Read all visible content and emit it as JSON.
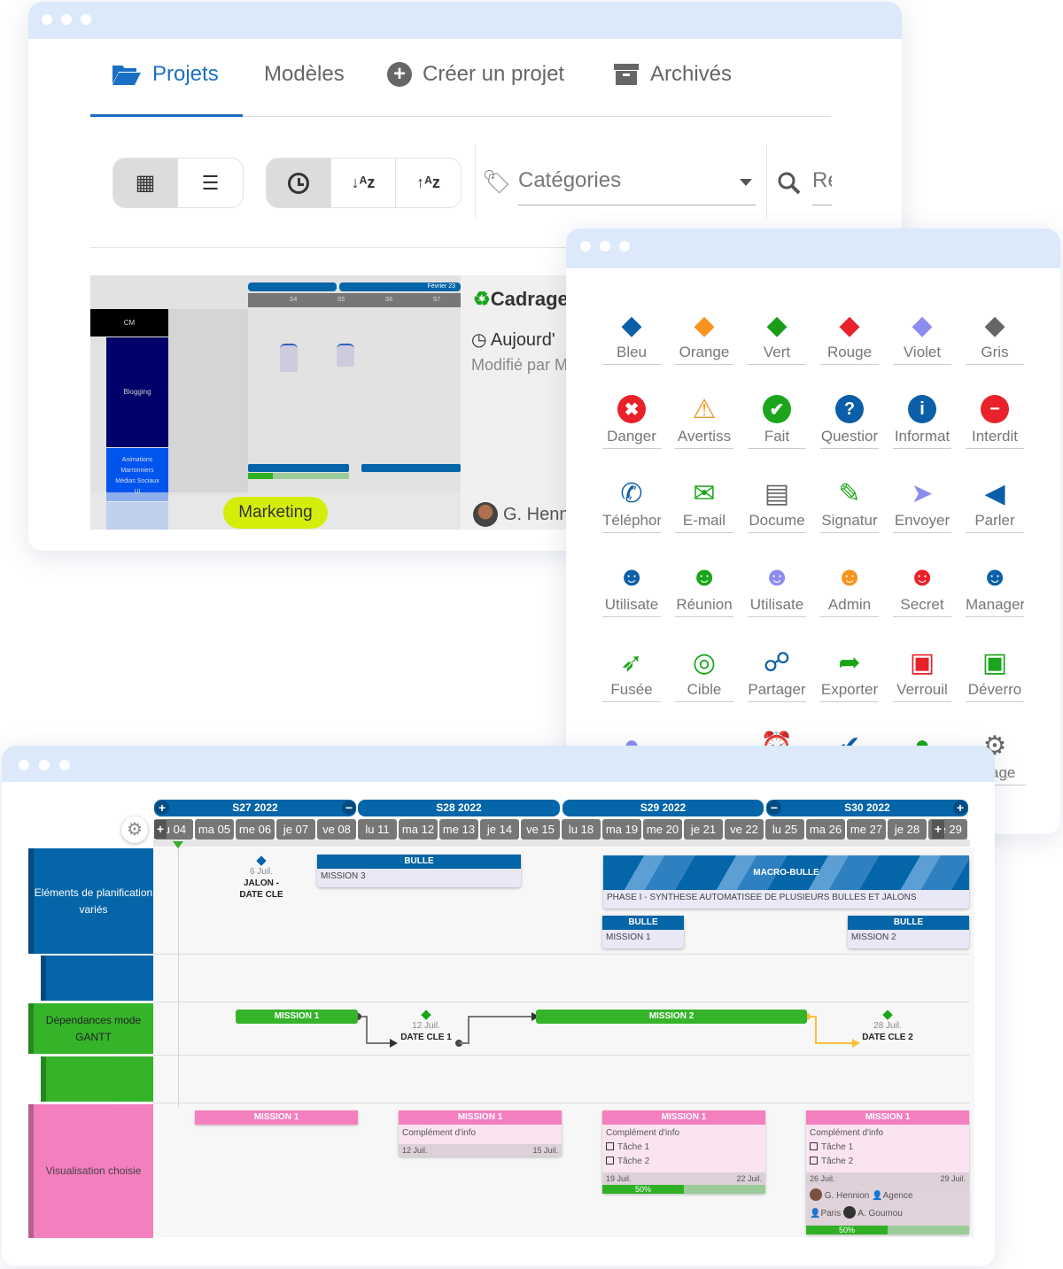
{
  "colors": {
    "accent": "#1a6fc4",
    "titlebar": "#dbe9fb",
    "gantt_blue": "#0465a8",
    "gantt_green": "#35b42a",
    "gantt_pink": "#f47fbf",
    "marketing": "#d4ee0a"
  },
  "projects_window": {
    "tabs": [
      {
        "label": "Projets",
        "icon": "folder-open-icon",
        "active": true
      },
      {
        "label": "Modèles"
      },
      {
        "label": "Créer un projet",
        "icon": "plus-circle-icon"
      },
      {
        "label": "Archivés",
        "icon": "archive-icon"
      }
    ],
    "view_buttons": [
      {
        "icon": "grid-icon",
        "active": true
      },
      {
        "icon": "list-icon"
      }
    ],
    "sort_buttons": [
      {
        "icon": "clock-icon",
        "active": true
      },
      {
        "icon": "sort-az-icon"
      },
      {
        "icon": "sort-za-icon"
      }
    ],
    "categories": {
      "icon": "tags-icon",
      "placeholder": "Catégories"
    },
    "search": {
      "icon": "search-icon",
      "placeholder": "Re"
    },
    "card": {
      "title": "Cadrage",
      "title_icon": "recycle-icon",
      "date": "Aujourd'",
      "modified": "Modifié par M",
      "owner": "G. Henn",
      "tag": "Marketing",
      "thumb": {
        "month": "Février 23",
        "weeks": [
          "S4",
          "S5",
          "S6",
          "S7"
        ],
        "rows": [
          "CM",
          "Blogging",
          "Animations",
          "Marronniers",
          "Médias Sociaux",
          "UI"
        ]
      }
    }
  },
  "icons_window": {
    "icons": [
      {
        "label": "Bleu",
        "glyph": "◆",
        "color": "#0a5fa8"
      },
      {
        "label": "Orange",
        "glyph": "◆",
        "color": "#f7931e"
      },
      {
        "label": "Vert",
        "glyph": "◆",
        "color": "#1a9e1a"
      },
      {
        "label": "Rouge",
        "glyph": "◆",
        "color": "#e8212a"
      },
      {
        "label": "Violet",
        "glyph": "◆",
        "color": "#8c8cef"
      },
      {
        "label": "Gris",
        "glyph": "◆",
        "color": "#666666"
      },
      {
        "label": "Danger",
        "glyph": "✖",
        "color": "#e8212a",
        "circle": true
      },
      {
        "label": "Avertiss",
        "glyph": "⚠",
        "color": "#f7931e"
      },
      {
        "label": "Fait",
        "glyph": "✔",
        "color": "#1aa51a",
        "circle": true
      },
      {
        "label": "Questior",
        "glyph": "?",
        "color": "#0a5fa8",
        "circle": true
      },
      {
        "label": "Informat",
        "glyph": "i",
        "color": "#0a5fa8",
        "circle": true
      },
      {
        "label": "Interdit",
        "glyph": "−",
        "color": "#e8212a",
        "circle": true
      },
      {
        "label": "Téléphor",
        "glyph": "✆",
        "color": "#0a5fa8"
      },
      {
        "label": "E-mail",
        "glyph": "✉",
        "color": "#1aa51a"
      },
      {
        "label": "Docume",
        "glyph": "▤",
        "color": "#666666"
      },
      {
        "label": "Signatur",
        "glyph": "✎",
        "color": "#1aa51a"
      },
      {
        "label": "Envoyer",
        "glyph": "➤",
        "color": "#8c8cef"
      },
      {
        "label": "Parler",
        "glyph": "◀",
        "color": "#0a5fa8"
      },
      {
        "label": "Utilisate",
        "glyph": "☻",
        "color": "#0a5fa8"
      },
      {
        "label": "Réunion",
        "glyph": "☻",
        "color": "#1aa51a"
      },
      {
        "label": "Utilisate",
        "glyph": "☻",
        "color": "#8c8cef"
      },
      {
        "label": "Admin",
        "glyph": "☻",
        "color": "#f7931e"
      },
      {
        "label": "Secret",
        "glyph": "☻",
        "color": "#e8212a"
      },
      {
        "label": "Manager",
        "glyph": "☻",
        "color": "#0a5fa8"
      },
      {
        "label": "Fusée",
        "glyph": "➶",
        "color": "#1aa51a"
      },
      {
        "label": "Cible",
        "glyph": "◎",
        "color": "#1aa51a"
      },
      {
        "label": "Partager",
        "glyph": "☍",
        "color": "#0a5fa8"
      },
      {
        "label": "Exporter",
        "glyph": "➦",
        "color": "#1aa51a"
      },
      {
        "label": "Verrouil",
        "glyph": "▣",
        "color": "#e8212a"
      },
      {
        "label": "Déverro",
        "glyph": "▣",
        "color": "#1aa51a"
      },
      {
        "label": "",
        "glyph": "●",
        "color": "#8c8cef"
      },
      {
        "label": "",
        "glyph": "▬",
        "color": "#f7931e"
      },
      {
        "label": "",
        "glyph": "⏰",
        "color": "#e8212a"
      },
      {
        "label": "",
        "glyph": "✔",
        "color": "#0a5fa8"
      },
      {
        "label": "",
        "glyph": "●",
        "color": "#1aa51a"
      },
      {
        "label": "age",
        "glyph": "⚙",
        "color": "#666666"
      }
    ]
  },
  "gantt": {
    "weeks": [
      "S27 2022",
      "S28 2022",
      "S29 2022",
      "S30 2022"
    ],
    "days": [
      "lu 04",
      "ma 05",
      "me 06",
      "je 07",
      "ve 08",
      "lu 11",
      "ma 12",
      "me 13",
      "je 14",
      "ve 15",
      "lu 18",
      "ma 19",
      "me 20",
      "je 21",
      "ve 22",
      "lu 25",
      "ma 26",
      "me 27",
      "je 28",
      "ve 29"
    ],
    "rows": [
      {
        "label": "Eléments de planification variés"
      },
      {
        "label": "Dépendances mode GANTT"
      },
      {
        "label": "Visualisation choisie"
      }
    ],
    "milestone1": {
      "date": "6 Juil.",
      "title": "JALON - DATE CLE"
    },
    "bulle_top": {
      "title": "BULLE",
      "body": "MISSION 3"
    },
    "macro": {
      "title": "MACRO-BULLE",
      "body": "PHASE I - SYNTHESE AUTOMATISEE DE PLUSIEURS BULLES ET JALONS"
    },
    "bulle_a": {
      "title": "BULLE",
      "body": "MISSION 1"
    },
    "bulle_b": {
      "title": "BULLE",
      "body": "MISSION 2"
    },
    "dep": {
      "m1": "MISSION 1",
      "m2": "MISSION 2",
      "k1_date": "12 Juil.",
      "k1": "DATE CLE 1",
      "k2_date": "28 Juil.",
      "k2": "DATE CLE 2"
    },
    "pink": {
      "c1": {
        "title": "MISSION 1"
      },
      "c2": {
        "title": "MISSION 1",
        "info": "Complément d'info",
        "start": "12 Juil.",
        "end": "15 Juil."
      },
      "c3": {
        "title": "MISSION 1",
        "info": "Complément d'info",
        "tasks": [
          "Tâche 1",
          "Tâche 2"
        ],
        "start": "19 Juil.",
        "end": "22 Juil.",
        "progress": 50,
        "progress_label": "50%"
      },
      "c4": {
        "title": "MISSION 1",
        "info": "Complément d'info",
        "tasks": [
          "Tâche 1",
          "Tâche 2"
        ],
        "start": "26 Juil.",
        "end": "29 Juil.",
        "people": [
          "G. Hennion",
          "Agence",
          "Paris",
          "A. Goumou"
        ],
        "progress": 50,
        "progress_label": "50%"
      }
    }
  }
}
